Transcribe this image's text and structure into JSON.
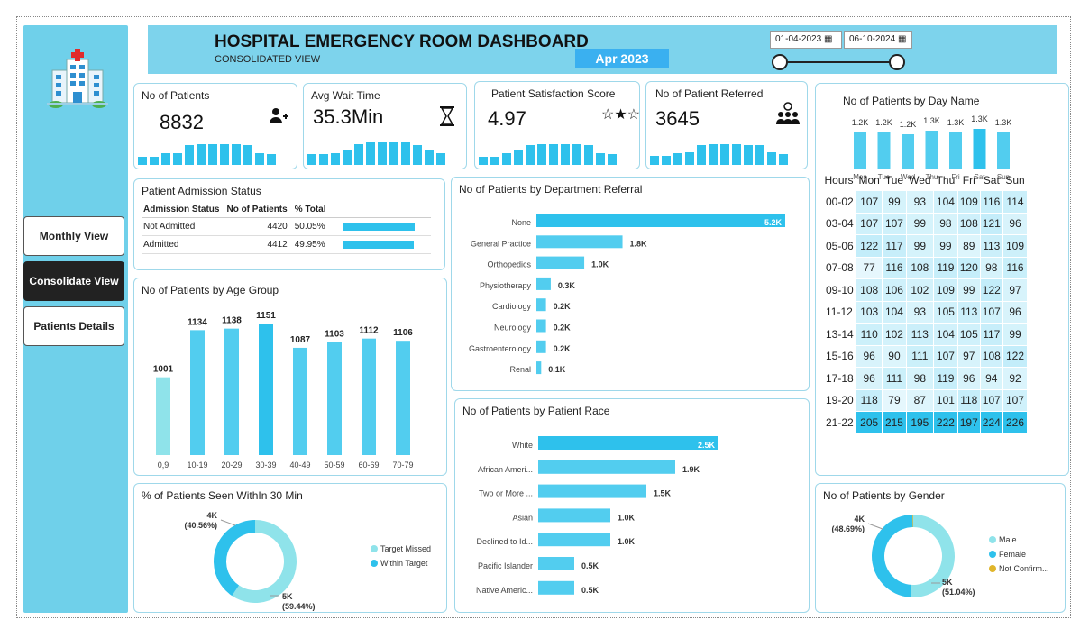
{
  "header": {
    "title": "HOSPITAL EMERGENCY ROOM DASHBOARD",
    "subtitle": "CONSOLIDATED VIEW",
    "month": "Apr 2023",
    "date_from": "01-04-2023",
    "date_to": "06-10-2024"
  },
  "nav": {
    "monthly": "Monthly View",
    "consolidate": "Consolidate View",
    "details": "Patients Details"
  },
  "kpis": [
    {
      "title": "No of Patients",
      "value": "8832",
      "icon": "add-user-icon"
    },
    {
      "title": "Avg Wait Time",
      "value": "35.3Min",
      "icon": "hourglass-icon"
    },
    {
      "title": "Patient Satisfaction Score",
      "value": "4.97",
      "icon": "stars-icon"
    },
    {
      "title": "No of Patient Referred",
      "value": "3645",
      "icon": "group-icon"
    }
  ],
  "admission": {
    "title": "Patient Admission Status",
    "headers": [
      "Admission Status",
      "No of Patients",
      "% Total"
    ],
    "rows": [
      {
        "status": "Not Admitted",
        "count": "4420",
        "pct": "50.05%",
        "frac": 0.5005
      },
      {
        "status": "Admitted",
        "count": "4412",
        "pct": "49.95%",
        "frac": 0.4995
      }
    ]
  },
  "age_title": "No of Patients by Age Group",
  "dept_title": "No of Patients by Department Referral",
  "race_title": "No of Patients by Patient Race",
  "within_title": "% of Patients Seen WithIn 30 Min",
  "day_title": "No of Patients by Day Name",
  "gender_title": "No of Patients by Gender",
  "chart_data": [
    {
      "type": "bar",
      "title": "No of Patients by Age Group",
      "categories": [
        "0,9",
        "10-19",
        "20-29",
        "30-39",
        "40-49",
        "50-59",
        "60-69",
        "70-79"
      ],
      "values": [
        1001,
        1134,
        1138,
        1151,
        1087,
        1103,
        1112,
        1106
      ],
      "labels": [
        "1001",
        "1134",
        "1138",
        "1151",
        "1087",
        "1103",
        "1112",
        "1106"
      ]
    },
    {
      "type": "bar",
      "orientation": "horizontal",
      "title": "No of Patients by Department Referral",
      "categories": [
        "None",
        "General Practice",
        "Orthopedics",
        "Physiotherapy",
        "Cardiology",
        "Neurology",
        "Gastroenterology",
        "Renal"
      ],
      "values": [
        5.2,
        1.8,
        1.0,
        0.3,
        0.2,
        0.2,
        0.2,
        0.1
      ],
      "labels": [
        "5.2K",
        "1.8K",
        "1.0K",
        "0.3K",
        "0.2K",
        "0.2K",
        "0.2K",
        "0.1K"
      ]
    },
    {
      "type": "bar",
      "orientation": "horizontal",
      "title": "No of Patients by Patient Race",
      "categories": [
        "White",
        "African Ameri...",
        "Two or More ...",
        "Asian",
        "Declined to Id...",
        "Pacific Islander",
        "Native Americ..."
      ],
      "values": [
        2.5,
        1.9,
        1.5,
        1.0,
        1.0,
        0.5,
        0.5
      ],
      "labels": [
        "2.5K",
        "1.9K",
        "1.5K",
        "1.0K",
        "1.0K",
        "0.5K",
        "0.5K"
      ]
    },
    {
      "type": "pie",
      "donut": true,
      "title": "% of Patients Seen WithIn 30 Min",
      "categories": [
        "Target Missed",
        "Within Target"
      ],
      "values": [
        59.44,
        40.56
      ],
      "labels": [
        "5K (59.44%)",
        "4K (40.56%)"
      ],
      "colors": [
        "#8fe3ea",
        "#2ec1ec"
      ]
    },
    {
      "type": "bar",
      "title": "No of Patients by Day Name",
      "categories": [
        "Mon",
        "Tue",
        "Wed",
        "Thu",
        "Fri",
        "Sat",
        "Sun"
      ],
      "values": [
        1.2,
        1.2,
        1.2,
        1.3,
        1.3,
        1.3,
        1.3
      ],
      "labels": [
        "1.2K",
        "1.2K",
        "1.2K",
        "1.3K",
        "1.3K",
        "1.3K",
        "1.3K"
      ]
    },
    {
      "type": "heatmap",
      "title": "Hours by Day",
      "x": [
        "Mon",
        "Tue",
        "Wed",
        "Thu",
        "Fri",
        "Sat",
        "Sun"
      ],
      "y": [
        "00-02",
        "03-04",
        "05-06",
        "07-08",
        "09-10",
        "11-12",
        "13-14",
        "15-16",
        "17-18",
        "19-20",
        "21-22"
      ],
      "values": [
        [
          107,
          99,
          93,
          104,
          109,
          116,
          114
        ],
        [
          107,
          107,
          99,
          98,
          108,
          121,
          96
        ],
        [
          122,
          117,
          99,
          99,
          89,
          113,
          109
        ],
        [
          77,
          116,
          108,
          119,
          120,
          98,
          116
        ],
        [
          108,
          106,
          102,
          109,
          99,
          122,
          97
        ],
        [
          103,
          104,
          93,
          105,
          113,
          107,
          96
        ],
        [
          110,
          102,
          113,
          104,
          105,
          117,
          99
        ],
        [
          96,
          90,
          111,
          107,
          97,
          108,
          122
        ],
        [
          96,
          111,
          98,
          119,
          96,
          94,
          92
        ],
        [
          118,
          79,
          87,
          101,
          118,
          107,
          107
        ],
        [
          205,
          215,
          195,
          222,
          197,
          224,
          226
        ]
      ],
      "row_header": "Hours"
    },
    {
      "type": "pie",
      "donut": true,
      "title": "No of Patients by Gender",
      "categories": [
        "Male",
        "Female",
        "Not Confirm..."
      ],
      "values": [
        51.04,
        48.69,
        0.27
      ],
      "labels": [
        "5K (51.04%)",
        "4K (48.69%)",
        ""
      ],
      "colors": [
        "#8fe3ea",
        "#2ec1ec",
        "#e0b52a"
      ]
    }
  ],
  "spark": {
    "patients": [
      0.35,
      0.35,
      0.5,
      0.5,
      0.85,
      0.9,
      0.9,
      0.9,
      0.9,
      0.85,
      0.5,
      0.45
    ],
    "wait": [
      0.45,
      0.45,
      0.5,
      0.6,
      0.9,
      0.95,
      0.95,
      0.95,
      0.95,
      0.85,
      0.6,
      0.5
    ],
    "score": [
      0.35,
      0.35,
      0.5,
      0.6,
      0.85,
      0.9,
      0.9,
      0.9,
      0.9,
      0.85,
      0.5,
      0.45
    ],
    "referred": [
      0.4,
      0.4,
      0.5,
      0.55,
      0.85,
      0.9,
      0.9,
      0.9,
      0.85,
      0.85,
      0.55,
      0.45
    ]
  },
  "colors": {
    "bar": "#2ec1ec",
    "bar_light": "#8fe3ea",
    "heat_low": "#e6f8fc",
    "heat_high": "#2ec1ec"
  }
}
